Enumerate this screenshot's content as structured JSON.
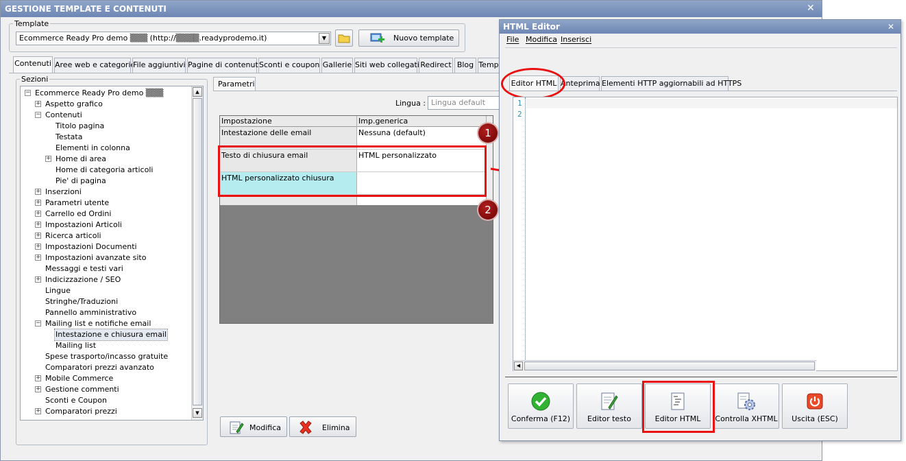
{
  "main_window": {
    "title": "GESTIONE TEMPLATE E CONTENUTI",
    "close_glyph": "✕",
    "template_group": {
      "label": "Template",
      "combo_value": "Ecommerce Ready Pro demo ▒▒▒ (http://▒▒▒▒.readyprodemo.it)",
      "new_template_label": "Nuovo template"
    },
    "tabs": [
      "Contenuti",
      "Aree web e categorie",
      "File aggiuntivi",
      "Pagine di contenuti",
      "Sconti e coupon",
      "Gallerie",
      "Siti web collegati",
      "Redirect",
      "Blog",
      "Temp"
    ],
    "sections_label": "Sezioni",
    "tree": [
      {
        "label": "Ecommerce Ready Pro demo ▒▒▒",
        "level": 0,
        "exp": "−"
      },
      {
        "label": "Aspetto grafico",
        "level": 1,
        "exp": "+"
      },
      {
        "label": "Contenuti",
        "level": 1,
        "exp": "−"
      },
      {
        "label": "Titolo pagina",
        "level": 2,
        "exp": ""
      },
      {
        "label": "Testata",
        "level": 2,
        "exp": ""
      },
      {
        "label": "Elementi in colonna",
        "level": 2,
        "exp": ""
      },
      {
        "label": "Home di area",
        "level": 2,
        "exp": "+"
      },
      {
        "label": "Home di categoria articoli",
        "level": 2,
        "exp": ""
      },
      {
        "label": "Pie' di pagina",
        "level": 2,
        "exp": ""
      },
      {
        "label": "Inserzioni",
        "level": 1,
        "exp": "+"
      },
      {
        "label": "Parametri utente",
        "level": 1,
        "exp": "+"
      },
      {
        "label": "Carrello ed Ordini",
        "level": 1,
        "exp": "+"
      },
      {
        "label": "Impostazioni Articoli",
        "level": 1,
        "exp": "+"
      },
      {
        "label": "Ricerca articoli",
        "level": 1,
        "exp": "+"
      },
      {
        "label": "Impostazioni Documenti",
        "level": 1,
        "exp": "+"
      },
      {
        "label": "Impostazioni avanzate sito",
        "level": 1,
        "exp": "+"
      },
      {
        "label": "Messaggi e testi vari",
        "level": 1,
        "exp": ""
      },
      {
        "label": "Indicizzazione / SEO",
        "level": 1,
        "exp": "+"
      },
      {
        "label": "Lingue",
        "level": 1,
        "exp": ""
      },
      {
        "label": "Stringhe/Traduzioni",
        "level": 1,
        "exp": ""
      },
      {
        "label": "Pannello amministrativo",
        "level": 1,
        "exp": ""
      },
      {
        "label": "Mailing list e notifiche email",
        "level": 1,
        "exp": "−"
      },
      {
        "label": "Intestazione e chiusura email",
        "level": 2,
        "exp": "",
        "selected": true
      },
      {
        "label": "Mailing list",
        "level": 2,
        "exp": ""
      },
      {
        "label": "Spese trasporto/incasso gratuite",
        "level": 1,
        "exp": ""
      },
      {
        "label": "Comparatori prezzi avanzato",
        "level": 1,
        "exp": ""
      },
      {
        "label": "Mobile Commerce",
        "level": 1,
        "exp": "+"
      },
      {
        "label": "Gestione commenti",
        "level": 1,
        "exp": "+"
      },
      {
        "label": "Sconti e Coupon",
        "level": 1,
        "exp": ""
      },
      {
        "label": "Comparatori prezzi",
        "level": 1,
        "exp": "+"
      }
    ],
    "params_tab": "Parametri",
    "lingua_label": "Lingua :",
    "lingua_placeholder": "Lingua default",
    "grid": {
      "headers": [
        "Impostazione",
        "Imp.generica"
      ],
      "rows": [
        {
          "name": "Intestazione delle email",
          "value": "Nessuna (default)"
        },
        {
          "name": "Testo di chiusura email",
          "value": "HTML personalizzato"
        },
        {
          "name": "HTML personalizzato chiusura",
          "value": ""
        }
      ]
    },
    "badges": [
      "1",
      "2"
    ],
    "modifica_label": "Modifica",
    "elimina_label": "Elimina"
  },
  "editor": {
    "title": "HTML Editor",
    "close_glyph": "✕",
    "menu": [
      "File",
      "Modifica",
      "Inserisci"
    ],
    "tabs": [
      "Editor HTML",
      "Anteprima",
      "Elementi HTTP aggiornabili ad HTTPS"
    ],
    "line_numbers": [
      "1",
      "2"
    ],
    "buttons": [
      {
        "label": "Conferma (F12)",
        "icon": "check-icon"
      },
      {
        "label": "Editor testo",
        "icon": "pencil-document-icon"
      },
      {
        "label": "Editor HTML",
        "icon": "html-document-icon"
      },
      {
        "label": "Controlla XHTML",
        "icon": "gear-document-icon"
      },
      {
        "label": "Uscita (ESC)",
        "icon": "power-icon"
      }
    ]
  },
  "colors": {
    "annotation_red": "#e81010",
    "highlight_cyan": "#b4ecf0",
    "title_blue": "#7a91be"
  }
}
